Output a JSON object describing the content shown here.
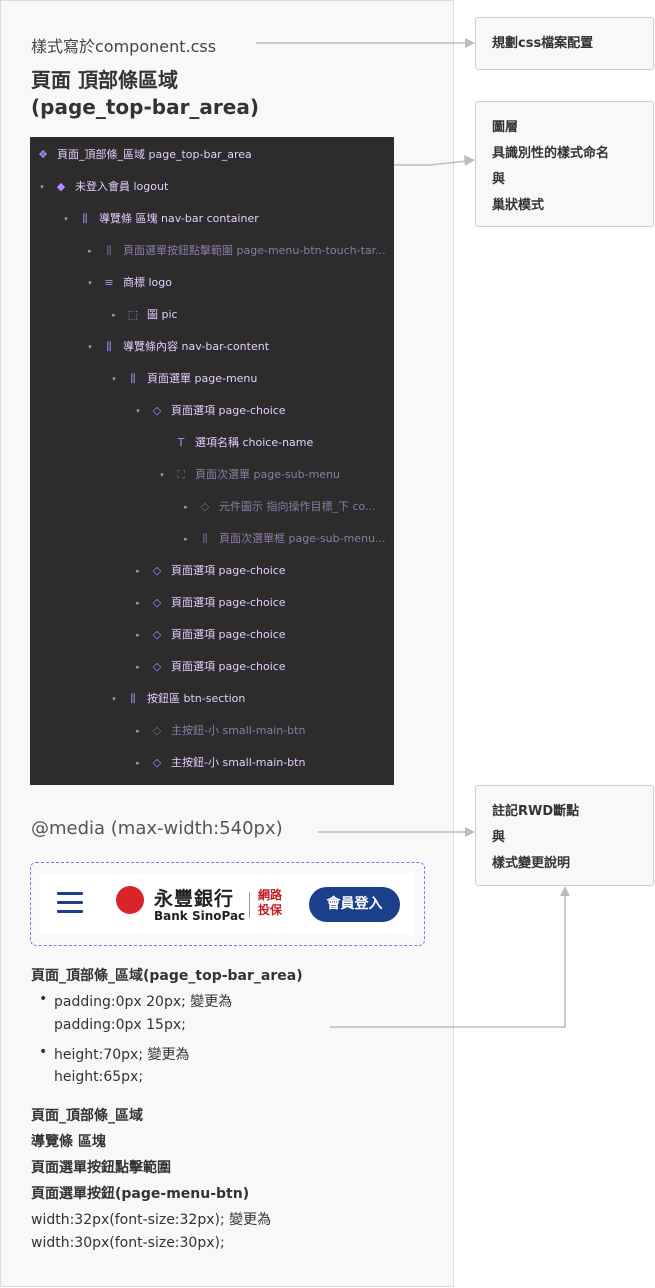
{
  "header": {
    "note": "樣式寫於component.css",
    "title_line1": "頁面 頂部條區域",
    "title_line2": "(page_top-bar_area)"
  },
  "side_notes": {
    "box1": "規劃css檔案配置",
    "box2": [
      "圖層",
      "具識別性的樣式命名",
      "與",
      "巢狀模式"
    ],
    "box3": [
      "註記RWD斷點",
      "與",
      "樣式變更說明"
    ]
  },
  "layers": [
    {
      "depth": 0,
      "arrow": "",
      "icon": "component-icon",
      "glyph": "❖",
      "label": "頁面_頂部條_區域 page_top-bar_area",
      "state": "on"
    },
    {
      "depth": 0,
      "arrow": "▾",
      "icon": "instance-icon",
      "glyph": "◆",
      "label": "未登入會員 logout",
      "state": "on"
    },
    {
      "depth": 1,
      "arrow": "▾",
      "icon": "auto-layout-icon",
      "glyph": "⫼",
      "label": "導覽條 區塊 nav-bar container",
      "state": "on"
    },
    {
      "depth": 2,
      "arrow": "▸",
      "icon": "auto-layout-icon",
      "glyph": "⫼",
      "label": "頁面選單按鈕點擊範圍 page-menu-btn-touch-tar...",
      "state": "dim"
    },
    {
      "depth": 2,
      "arrow": "▾",
      "icon": "text-align-icon",
      "glyph": "≡",
      "label": "商標 logo",
      "state": "on"
    },
    {
      "depth": 3,
      "arrow": "▸",
      "icon": "frame-icon",
      "glyph": "⬚",
      "label": "圖 pic",
      "state": "on"
    },
    {
      "depth": 2,
      "arrow": "▾",
      "icon": "auto-layout-icon",
      "glyph": "⫼",
      "label": "導覽條內容 nav-bar-content",
      "state": "on"
    },
    {
      "depth": 3,
      "arrow": "▾",
      "icon": "auto-layout-icon",
      "glyph": "⫼",
      "label": "頁面選單 page-menu",
      "state": "on"
    },
    {
      "depth": 4,
      "arrow": "▾",
      "icon": "instance-outline-icon",
      "glyph": "◇",
      "label": "頁面選項 page-choice",
      "state": "on"
    },
    {
      "depth": 5,
      "arrow": "",
      "icon": "text-layer-icon",
      "glyph": "T",
      "label": "選項名稱 choice-name",
      "state": "on"
    },
    {
      "depth": 5,
      "arrow": "▾",
      "icon": "dashed-frame-icon",
      "glyph": "⛶",
      "label": "頁面次選單 page-sub-menu",
      "state": "dim"
    },
    {
      "depth": 6,
      "arrow": "▸",
      "icon": "instance-outline-icon",
      "glyph": "◇",
      "label": "元件圖示 指向操作目標_下 co...",
      "state": "dim"
    },
    {
      "depth": 6,
      "arrow": "▸",
      "icon": "auto-layout-icon",
      "glyph": "⫼",
      "label": "頁面次選單框 page-sub-menu...",
      "state": "dim"
    },
    {
      "depth": 4,
      "arrow": "▸",
      "icon": "instance-outline-icon",
      "glyph": "◇",
      "label": "頁面選項 page-choice",
      "state": "on"
    },
    {
      "depth": 4,
      "arrow": "▸",
      "icon": "instance-outline-icon",
      "glyph": "◇",
      "label": "頁面選項 page-choice",
      "state": "on"
    },
    {
      "depth": 4,
      "arrow": "▸",
      "icon": "instance-outline-icon",
      "glyph": "◇",
      "label": "頁面選項 page-choice",
      "state": "on"
    },
    {
      "depth": 4,
      "arrow": "▸",
      "icon": "instance-outline-icon",
      "glyph": "◇",
      "label": "頁面選項 page-choice",
      "state": "on"
    },
    {
      "depth": 3,
      "arrow": "▾",
      "icon": "auto-layout-icon",
      "glyph": "⫼",
      "label": "按鈕區 btn-section",
      "state": "on"
    },
    {
      "depth": 4,
      "arrow": "▸",
      "icon": "instance-outline-icon",
      "glyph": "◇",
      "label": "主按鈕-小 small-main-btn",
      "state": "dim"
    },
    {
      "depth": 4,
      "arrow": "▸",
      "icon": "instance-outline-icon",
      "glyph": "◇",
      "label": "主按鈕-小 small-main-btn",
      "state": "on"
    }
  ],
  "media_query": "@media (max-width:540px)",
  "preview": {
    "brand_cn": "永豐銀行",
    "brand_en": "Bank SinoPac",
    "brand_net_line1": "網路",
    "brand_net_line2": "投保",
    "login_label": "會員登入",
    "colors": {
      "navy": "#1c3f8c",
      "red": "#d8242a",
      "dashed_border": "#9b6bf2"
    }
  },
  "notes": {
    "heading": "頁面_頂部條_區域(page_top-bar_area)",
    "bullet1_line1": "padding:0px 20px; 變更為",
    "bullet1_line2": "padding:0px 15px;",
    "bullet2_line1": "height:70px; 變更為",
    "bullet2_line2": "height:65px;",
    "path1": "頁面_頂部條_區域",
    "path2": "導覽條 區塊",
    "path3": "頁面選單按鈕點擊範圍",
    "path4": "頁面選單按鈕(page-menu-btn)",
    "change1": "width:32px(font-size:32px); 變更為",
    "change2": "width:30px(font-size:30px);"
  }
}
